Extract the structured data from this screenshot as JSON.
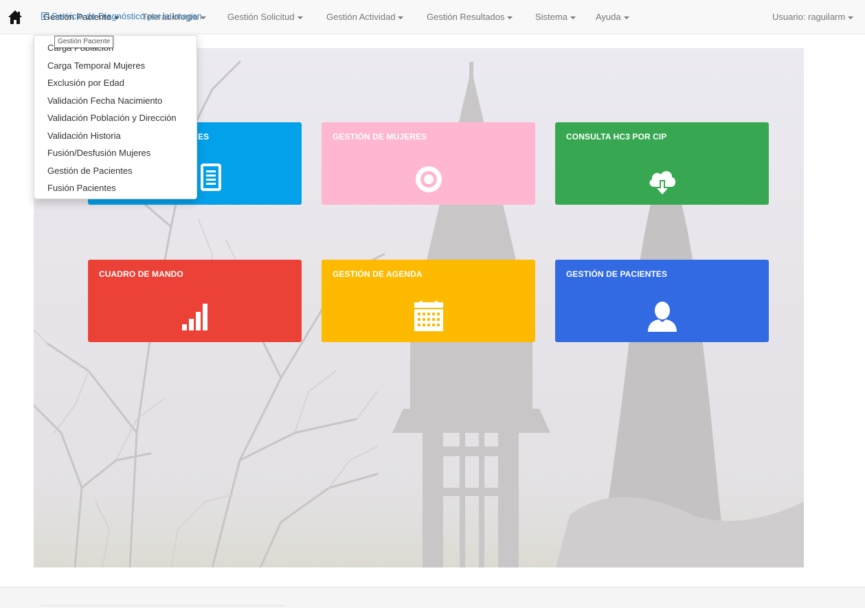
{
  "nav": {
    "items": [
      {
        "label": "Gestión Paciente",
        "active": true
      },
      {
        "label": "Teleradiología"
      },
      {
        "label": "Gestión Solicitud"
      },
      {
        "label": "Gestión Actividad"
      },
      {
        "label": "Gestión Resultados"
      },
      {
        "label": "Sistema"
      },
      {
        "label": "Ayuda"
      }
    ],
    "user": "Usuario: raguilarm"
  },
  "tooltip": "Gestión Paciente",
  "dropdown": {
    "items": [
      "Carga Población",
      "Carga Temporal Mujeres",
      "Exclusión por Edad",
      "Validación Fecha Nacimiento",
      "Validación Población y Dirección",
      "Validación Historia",
      "Fusión/Desfusión Mujeres",
      "Gestión de Pacientes",
      "Fusión Pacientes"
    ]
  },
  "tiles": [
    {
      "title": "ES",
      "color": "#03a1ea",
      "icon": "document-icon"
    },
    {
      "title": "GESTIÓN DE MUJERES",
      "color": "#ffb6d0",
      "icon": "target-icon"
    },
    {
      "title": "CONSULTA HC3 POR CIP",
      "color": "#37a851",
      "icon": "cloud-download-icon"
    },
    {
      "title": "CUADRO DE MANDO",
      "color": "#ec4136",
      "icon": "signal-bars-icon"
    },
    {
      "title": "GESTIÓN DE AGENDA",
      "color": "#fdba00",
      "icon": "calendar-icon"
    },
    {
      "title": "GESTIÓN DE PACIENTES",
      "color": "#326ae3",
      "icon": "user-icon"
    }
  ],
  "footer": {
    "link": "Servicio de Diagnóstico por la Imagen"
  }
}
